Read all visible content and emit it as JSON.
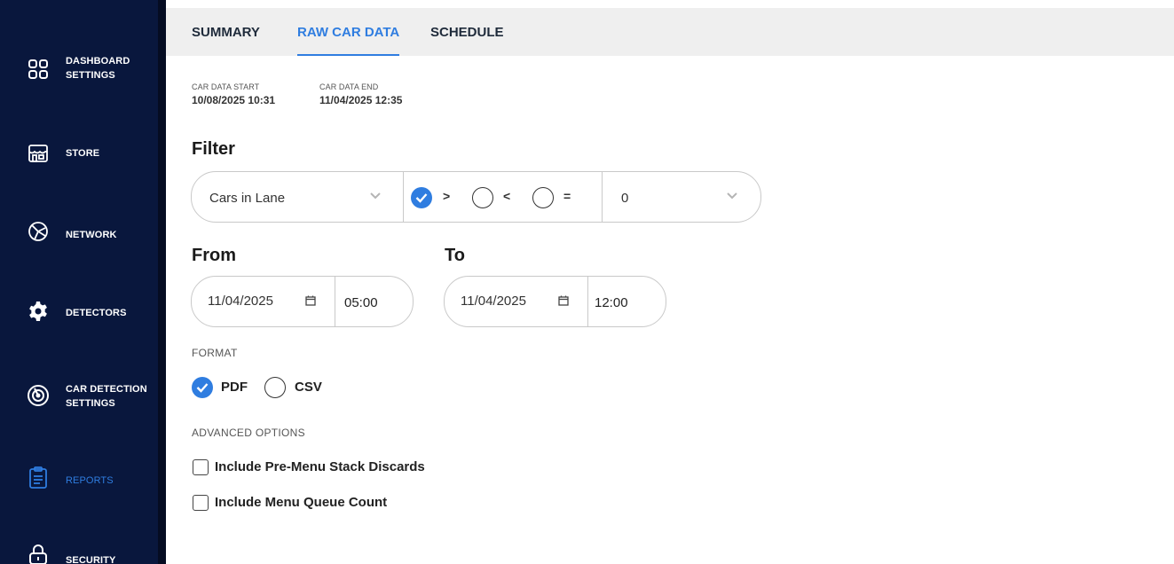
{
  "sidebar": {
    "items": [
      {
        "label": "DASHBOARD\nSETTINGS",
        "icon": "dashboard-grid-icon"
      },
      {
        "label": "STORE",
        "icon": "store-icon"
      },
      {
        "label": "NETWORK",
        "icon": "network-globe-icon"
      },
      {
        "label": "DETECTORS",
        "icon": "gear-icon"
      },
      {
        "label": "CAR DETECTION\nSETTINGS",
        "icon": "detection-target-icon"
      },
      {
        "label": "REPORTS",
        "icon": "clipboard-icon",
        "active": true
      },
      {
        "label": "SECURITY",
        "icon": "lock-icon"
      }
    ]
  },
  "tabs": [
    {
      "label": "SUMMARY"
    },
    {
      "label": "RAW CAR DATA",
      "active": true
    },
    {
      "label": "SCHEDULE"
    }
  ],
  "car_data": {
    "start_label": "CAR DATA START",
    "start_value": "10/08/2025 10:31",
    "end_label": "CAR DATA END",
    "end_value": "11/04/2025 12:35"
  },
  "filter": {
    "title": "Filter",
    "field": "Cars in Lane",
    "operators": [
      {
        "symbol": ">",
        "selected": true
      },
      {
        "symbol": "<",
        "selected": false
      },
      {
        "symbol": "=",
        "selected": false
      }
    ],
    "value": "0"
  },
  "range": {
    "from_title": "From",
    "from_date": "11/04/2025",
    "from_time": "05:00",
    "to_title": "To",
    "to_date": "11/04/2025",
    "to_time": "12:00"
  },
  "format": {
    "label": "FORMAT",
    "options": [
      {
        "label": "PDF",
        "selected": true
      },
      {
        "label": "CSV",
        "selected": false
      }
    ]
  },
  "advanced": {
    "label": "ADVANCED OPTIONS",
    "options": [
      {
        "label": "Include Pre-Menu Stack Discards",
        "checked": false
      },
      {
        "label": "Include Menu Queue Count",
        "checked": false
      }
    ]
  },
  "colors": {
    "sidebar_bg": "#09173d",
    "accent": "#2f7de0",
    "tabbar_bg": "#efefef"
  }
}
